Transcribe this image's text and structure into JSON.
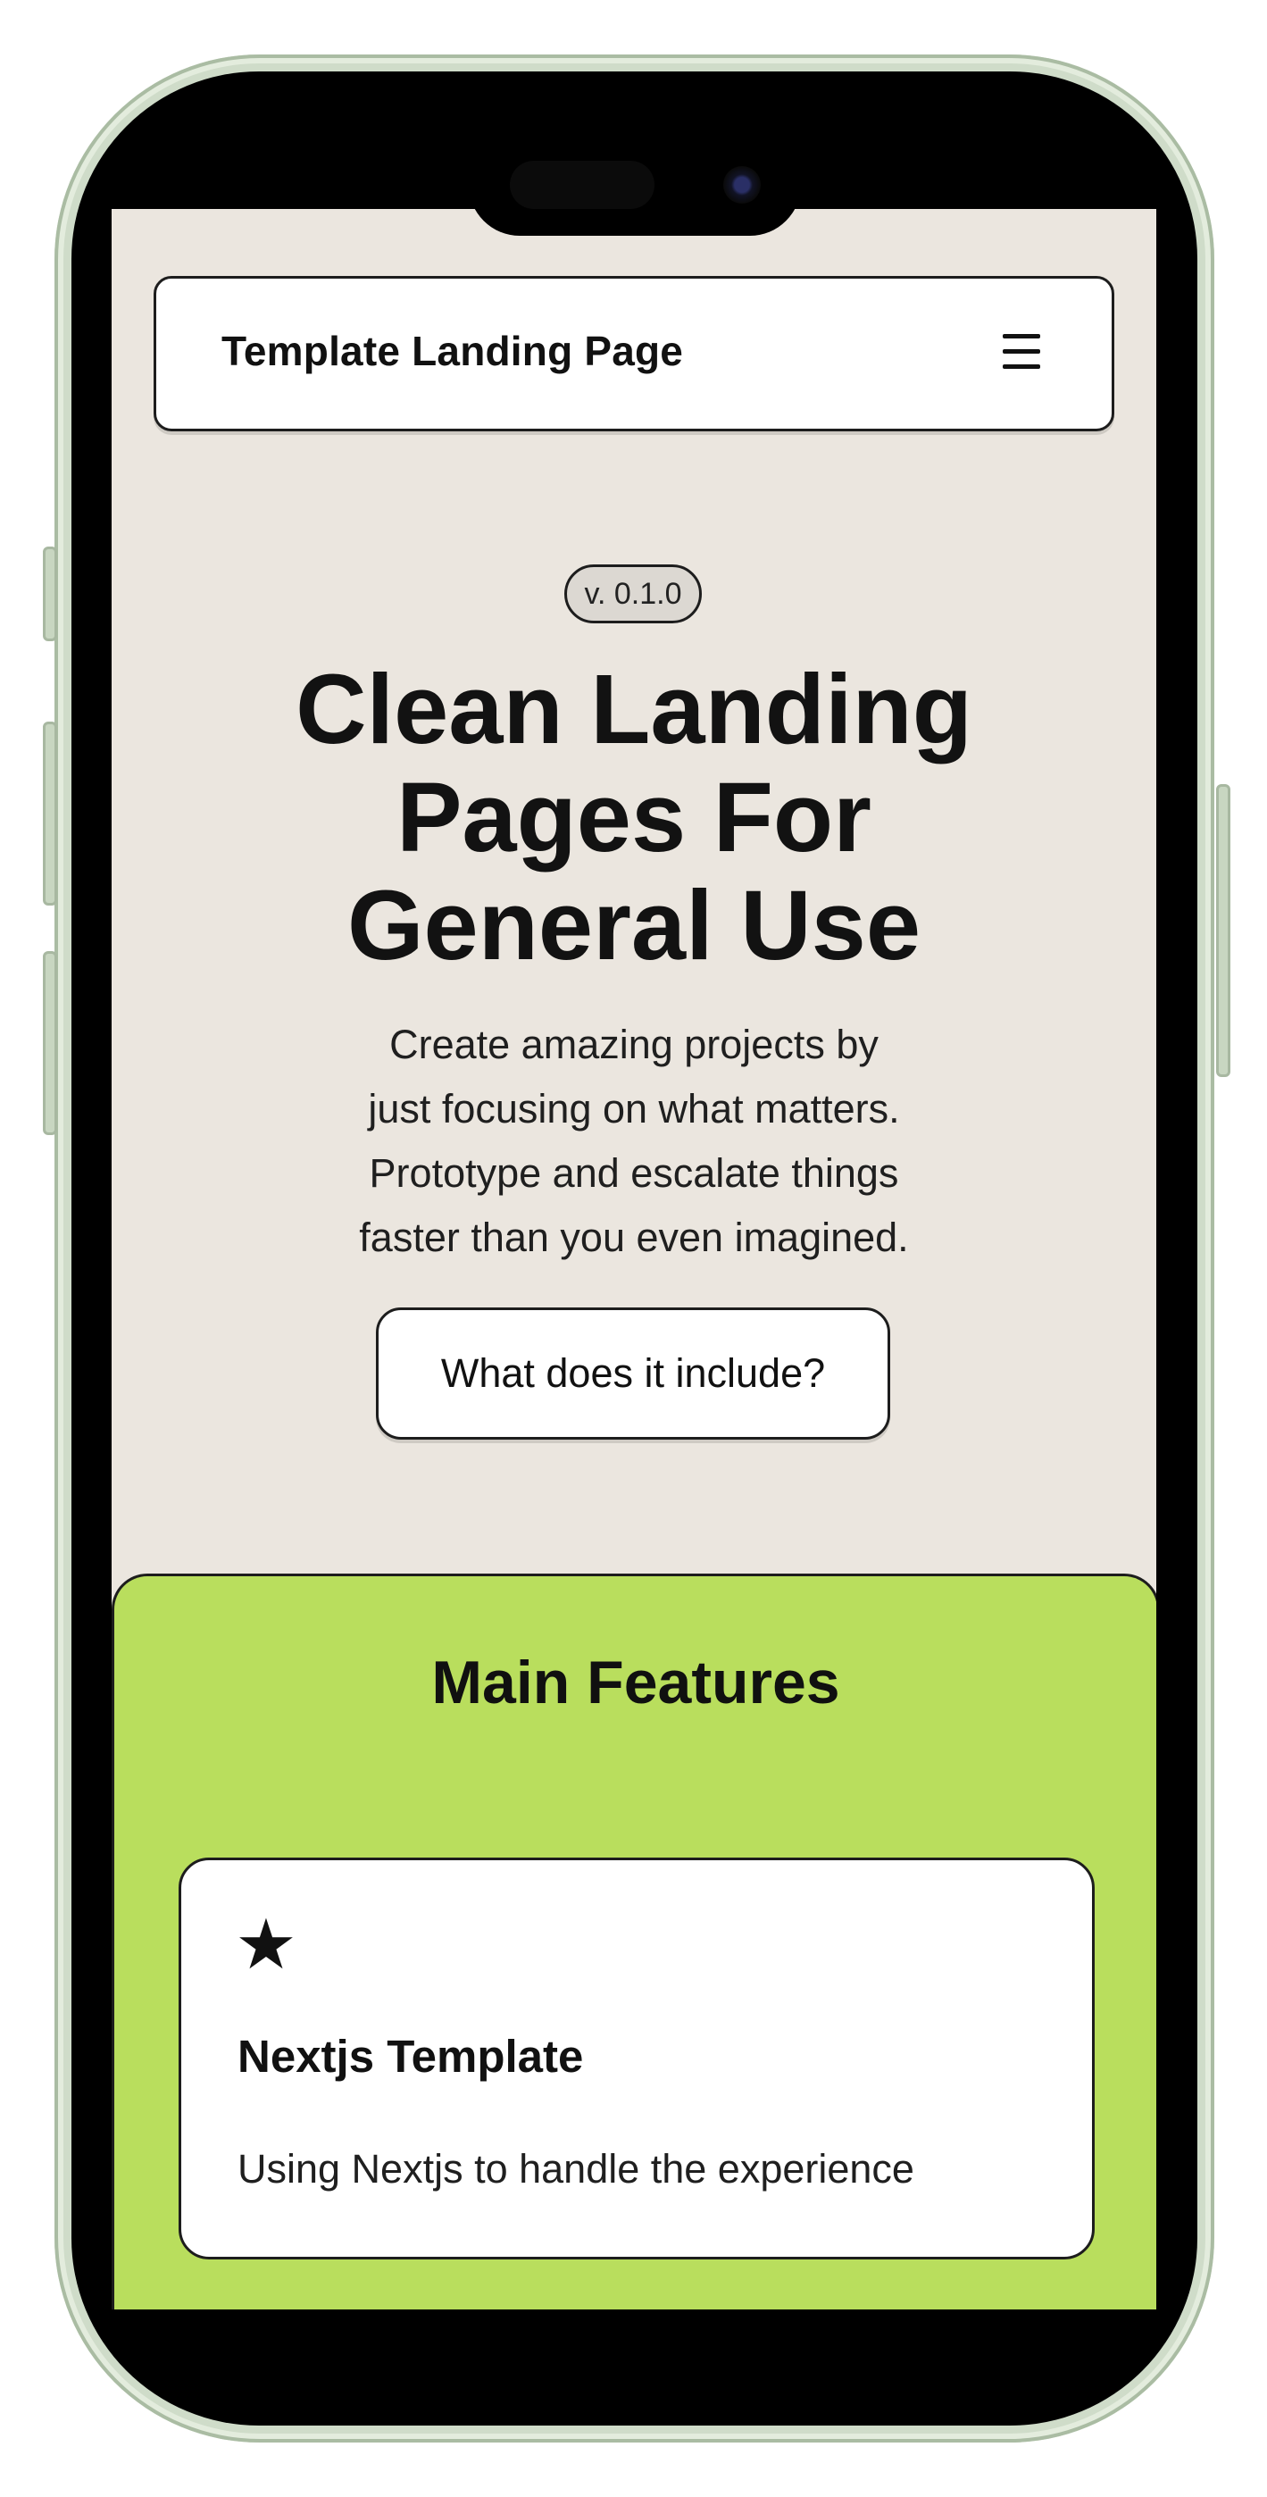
{
  "navbar": {
    "brand": "Template Landing Page",
    "menu_icon": "hamburger-menu-icon"
  },
  "hero": {
    "version": "v. 0.1.0",
    "title_lines": [
      "Clean Landing",
      "Pages For",
      "General Use"
    ],
    "subtitle_lines": [
      "Create amazing projects by",
      "just focusing on what matters.",
      "Prototype and escalate things",
      "faster than you even imagined."
    ],
    "cta_label": "What does it include?"
  },
  "features": {
    "title": "Main Features",
    "cards": [
      {
        "icon": "star-icon",
        "title": "Nextjs Template",
        "text": "Using Nextjs to handle the experience"
      }
    ]
  },
  "colors": {
    "page_bg": "#ebe6df",
    "features_bg": "#b9de5d",
    "border": "#1d1d1d",
    "phone_frame": "#cfdcc9"
  }
}
